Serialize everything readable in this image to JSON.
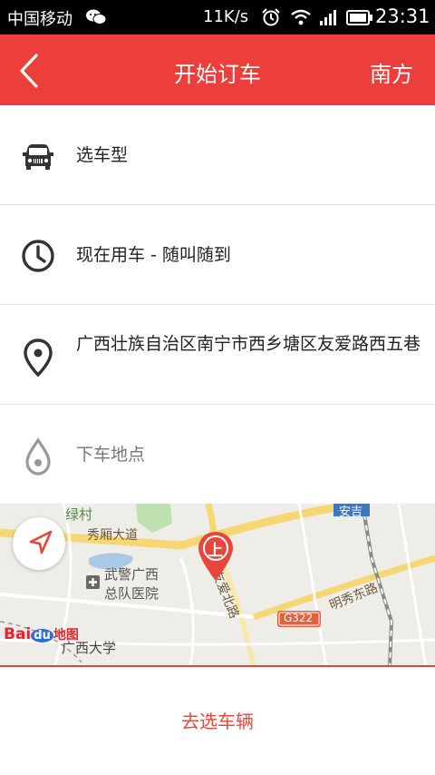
{
  "status_bar": {
    "carrier": "中国移动",
    "speed": "11K/s",
    "time": "23:31",
    "icons": [
      "wechat-icon",
      "alarm-icon",
      "wifi-icon",
      "signal-icon",
      "battery-icon"
    ]
  },
  "header": {
    "title": "开始订车",
    "city": "南方",
    "color": "#ec3f3b"
  },
  "rows": {
    "car_type": {
      "label": "选车型",
      "icon": "car-icon"
    },
    "time": {
      "label": "现在用车 - 随叫随到",
      "icon": "clock-icon"
    },
    "pickup": {
      "label": "广西壮族自治区南宁市西乡塘区友爱路西五巷",
      "icon": "location-pin-icon"
    },
    "dropoff": {
      "label": "下车地点",
      "icon": "drop-pin-icon"
    }
  },
  "map": {
    "labels": {
      "lucun": "绿村",
      "xiuxiang": "秀厢大道",
      "hospital_1": "武警广西",
      "hospital_2": "总队医院",
      "youai": "友爱北路",
      "mingxiu": "明秀东路",
      "g322": "G322",
      "anji": "安吉",
      "guangxi_univ": "广西大学",
      "marker": "上"
    },
    "logo_baidu": "Bai",
    "logo_du": "du",
    "logo_map": "地图"
  },
  "footer": {
    "go_button": "去选车辆",
    "accent": "#e84a3f"
  }
}
